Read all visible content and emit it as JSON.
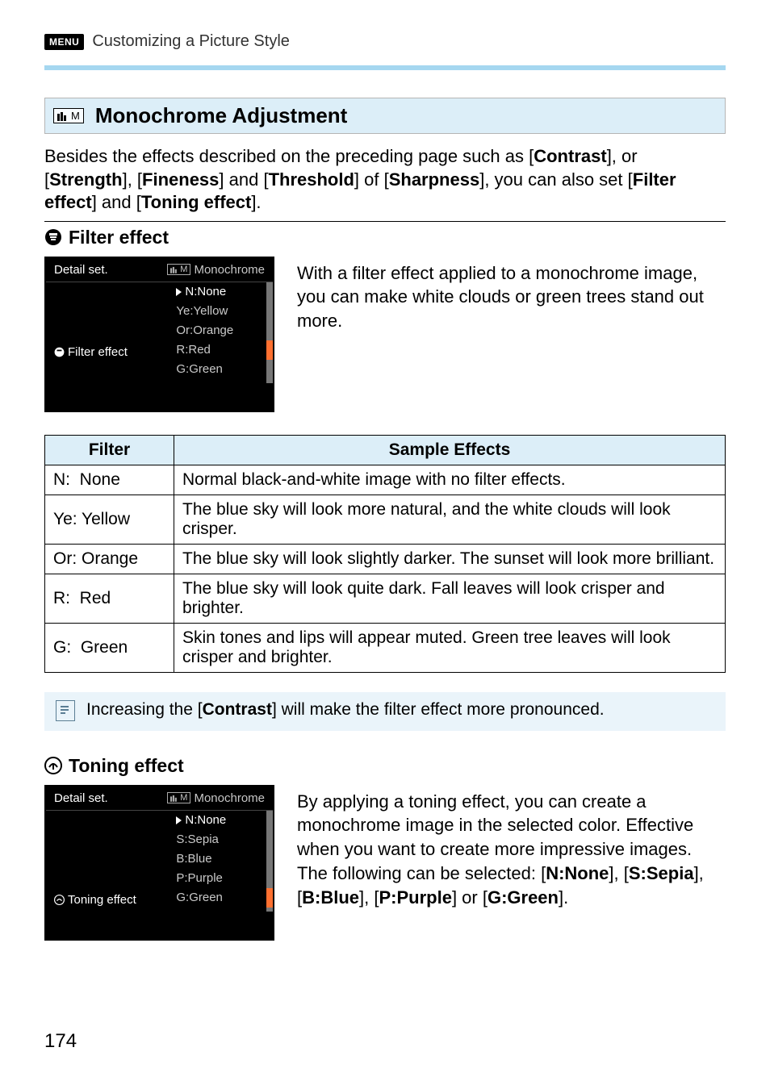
{
  "header": {
    "menu_chip": "MENU",
    "title": "Customizing a Picture Style"
  },
  "section": {
    "ps_m": "M",
    "title": "Monochrome Adjustment"
  },
  "intro": {
    "line1_pre": "Besides the effects described on the preceding page such as ",
    "line2_a": "[",
    "line2_contrast": "Contrast",
    "line2_b": "], or [",
    "line2_strength": "Strength",
    "line2_c": "], [",
    "line2_fineness": "Fineness",
    "line2_d": "] and [",
    "line2_threshold": "Threshold",
    "line2_e": "] of [",
    "line2_sharpness": "Sharpness",
    "line2_f": "], ",
    "line3_a": "you can also set [",
    "line3_filter": "Filter effect",
    "line3_b": "] and [",
    "line3_toning": "Toning effect",
    "line3_c": "]."
  },
  "filter_section": {
    "heading": "Filter effect",
    "lcd_title": "Detail set.",
    "lcd_style_label": "Monochrome",
    "lcd_ps_m": "M",
    "options": [
      {
        "label": "N:None",
        "selected": true
      },
      {
        "label": "Ye:Yellow"
      },
      {
        "label": "Or:Orange"
      },
      {
        "label": "R:Red"
      },
      {
        "label": "G:Green"
      }
    ],
    "left_label": "Filter effect",
    "desc": "With a filter effect applied to a monochrome image, you can make white clouds or green trees stand out more."
  },
  "filter_table": {
    "headers": {
      "filter": "Filter",
      "effects": "Sample Effects"
    },
    "rows": [
      {
        "filter": "N:  None",
        "effect": "Normal black-and-white image with no filter effects."
      },
      {
        "filter": "Ye: Yellow",
        "effect": "The blue sky will look more natural, and the white clouds will look crisper."
      },
      {
        "filter": "Or: Orange",
        "effect": "The blue sky will look slightly darker. The sunset will look more brilliant."
      },
      {
        "filter": "R:  Red",
        "effect": "The blue sky will look quite dark. Fall leaves will look crisper and brighter."
      },
      {
        "filter": "G:  Green",
        "effect": "Skin tones and lips will appear muted. Green tree leaves will look crisper and brighter."
      }
    ]
  },
  "note": {
    "pre": "Increasing the [",
    "bold": "Contrast",
    "post": "] will make the filter effect more pronounced."
  },
  "toning_section": {
    "heading": "Toning effect",
    "lcd_title": "Detail set.",
    "lcd_style_label": "Monochrome",
    "lcd_ps_m": "M",
    "options": [
      {
        "label": "N:None",
        "selected": true
      },
      {
        "label": "S:Sepia"
      },
      {
        "label": "B:Blue"
      },
      {
        "label": "P:Purple"
      },
      {
        "label": "G:Green"
      }
    ],
    "left_label": "Toning effect",
    "desc_a": "By applying a toning effect, you can create a monochrome image in the selected color. Effective when you want to create more impressive images.",
    "desc_b_pre": "The following can be selected: [",
    "desc_b_n": "N:None",
    "desc_b_1": "], [",
    "desc_b_s": "S:Sepia",
    "desc_b_2": "], [",
    "desc_b_b": "B:Blue",
    "desc_b_3": "], [",
    "desc_b_p": "P:Purple",
    "desc_b_4": "] or [",
    "desc_b_g": "G:Green",
    "desc_b_end": "]."
  },
  "page_number": "174"
}
